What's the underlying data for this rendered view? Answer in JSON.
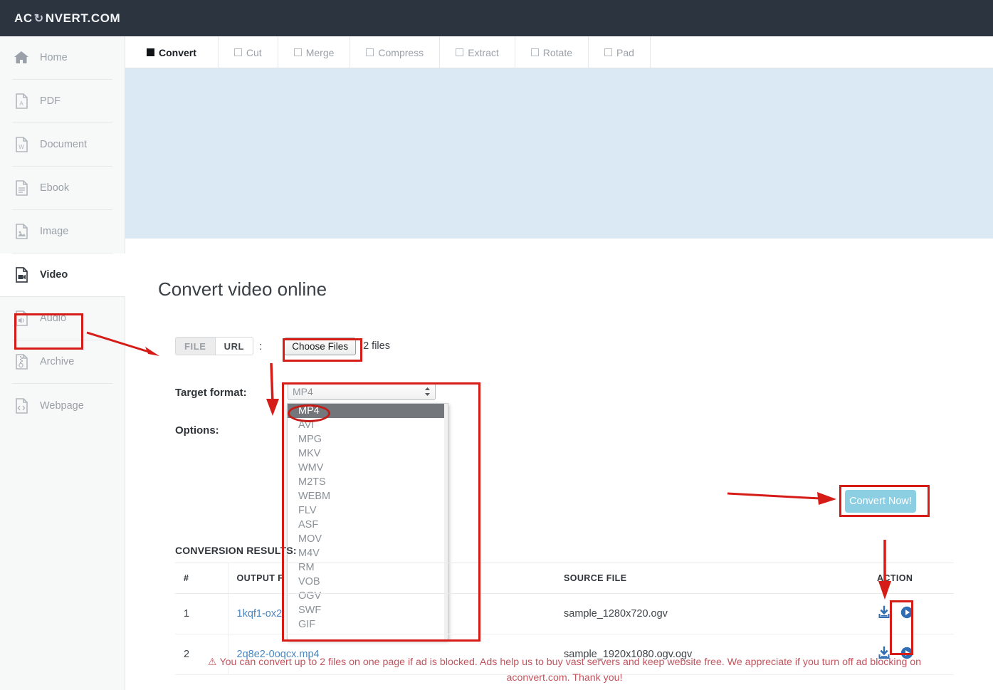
{
  "header": {
    "logo_prefix": "AC",
    "logo_icon": "sync-arrows-icon",
    "logo_suffix": "NVERT.COM"
  },
  "tabs": [
    {
      "label": "Convert",
      "active": true
    },
    {
      "label": "Cut",
      "active": false
    },
    {
      "label": "Merge",
      "active": false
    },
    {
      "label": "Compress",
      "active": false
    },
    {
      "label": "Extract",
      "active": false
    },
    {
      "label": "Rotate",
      "active": false
    },
    {
      "label": "Pad",
      "active": false
    }
  ],
  "sidebar": {
    "items": [
      {
        "label": "Home",
        "icon": "home-icon",
        "active": false
      },
      {
        "label": "PDF",
        "icon": "pdf-file-icon",
        "active": false
      },
      {
        "label": "Document",
        "icon": "word-document-icon",
        "active": false
      },
      {
        "label": "Ebook",
        "icon": "ebook-file-icon",
        "active": false
      },
      {
        "label": "Image",
        "icon": "image-file-icon",
        "active": false
      },
      {
        "label": "Video",
        "icon": "video-file-icon",
        "active": true
      },
      {
        "label": "Audio",
        "icon": "audio-file-icon",
        "active": false
      },
      {
        "label": "Archive",
        "icon": "archive-file-icon",
        "active": false
      },
      {
        "label": "Webpage",
        "icon": "code-file-icon",
        "active": false
      }
    ]
  },
  "main": {
    "title": "Convert video online",
    "source_toggle": {
      "file_label": "FILE",
      "url_label": "URL",
      "separator": ":"
    },
    "choose_files_label": "Choose Files",
    "files_count_text": "2 files",
    "target_format_label": "Target format:",
    "options_label": "Options:",
    "convert_button_label": "Convert Now!",
    "results_label": "CONVERSION RESULTS:"
  },
  "format_select": {
    "value": "MP4",
    "spinner_icon": "up-down-spinner-icon",
    "options": [
      "MP4",
      "AVI",
      "MPG",
      "MKV",
      "WMV",
      "M2TS",
      "WEBM",
      "FLV",
      "ASF",
      "MOV",
      "M4V",
      "RM",
      "VOB",
      "OGV",
      "SWF",
      "GIF"
    ],
    "selected_option": "MP4"
  },
  "results_table": {
    "columns": [
      "#",
      "OUTPUT F",
      "SOURCE FILE",
      "ACTION"
    ],
    "rows": [
      {
        "num": "1",
        "output_file": "1kqf1-ox2",
        "source_file": "sample_1280x720.ogv",
        "actions": [
          "download-icon",
          "play-icon"
        ]
      },
      {
        "num": "2",
        "output_file": "2q8e2-0oqcx.mp4",
        "source_file": "sample_1920x1080.ogv.ogv",
        "actions": [
          "download-icon",
          "play-icon"
        ]
      }
    ]
  },
  "warning": {
    "icon": "warning-triangle-icon",
    "text": "You can convert up to 2 files on one page if ad is blocked. Ads help us to buy vast servers and keep website free. We appreciate if you turn off ad blocking on aconvert.com. Thank you!"
  },
  "colors": {
    "header_bg": "#2c3440",
    "banner_bg": "#dbe9f4",
    "convert_button": "#8ccfe3",
    "annotation_red": "#d61c17",
    "link_blue": "#4a87bf",
    "warning_red": "#c0555e"
  }
}
